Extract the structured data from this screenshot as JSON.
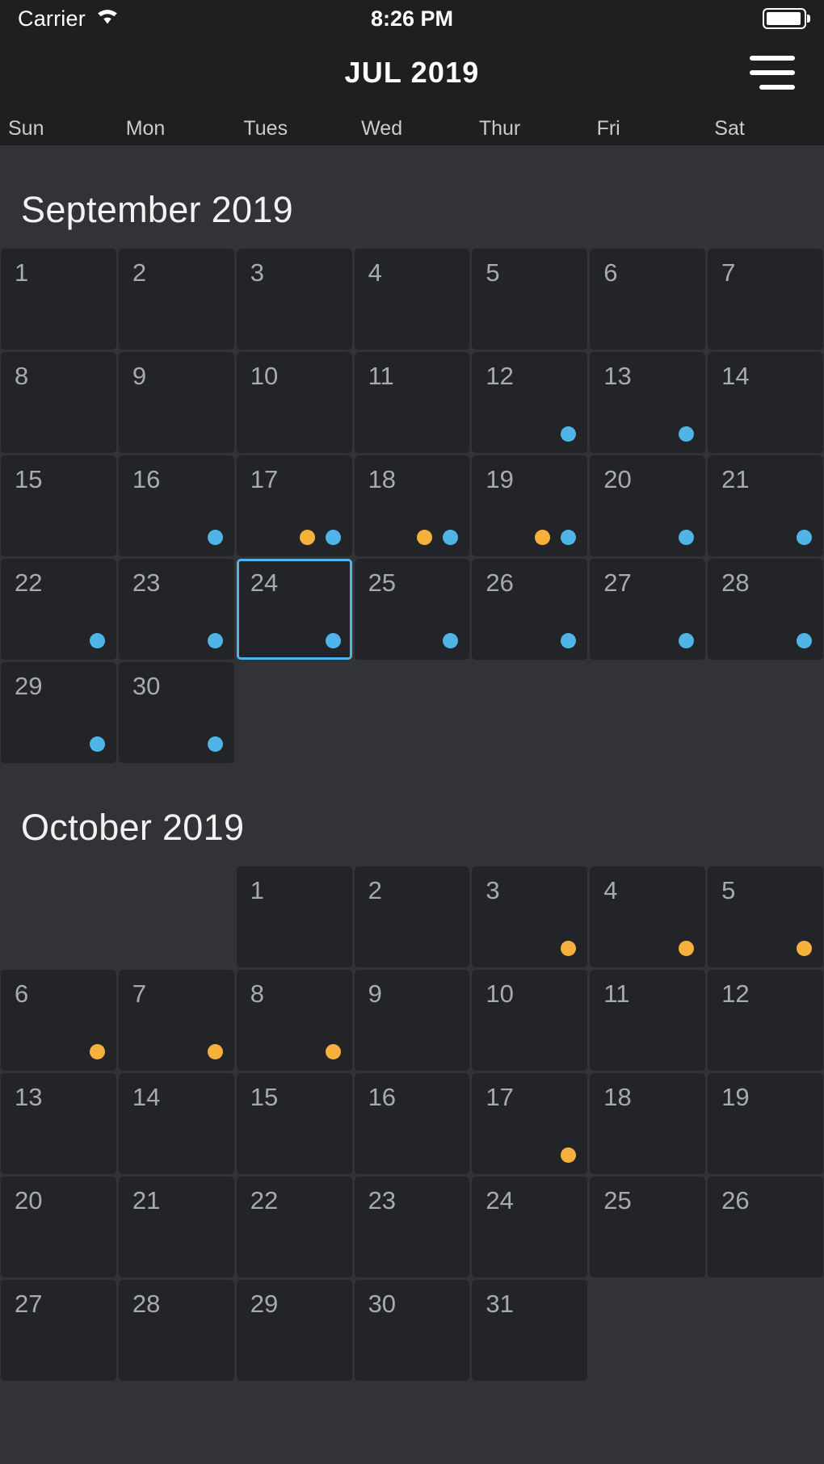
{
  "status_bar": {
    "carrier": "Carrier",
    "time": "8:26 PM",
    "wifi_icon": "wifi-icon",
    "battery_icon": "battery-icon"
  },
  "nav_bar": {
    "title": "JUL 2019",
    "menu_icon": "hamburger-menu-icon"
  },
  "weekdays": [
    "Sun",
    "Mon",
    "Tues",
    "Wed",
    "Thur",
    "Fri",
    "Sat"
  ],
  "colors": {
    "background": "#313336",
    "cell": "#232427",
    "header": "#1e1f21",
    "accent_blue": "#4fb4e8",
    "accent_orange": "#f5b13c",
    "day_text": "#a8abae",
    "title_text": "#f2f2f2"
  },
  "months": [
    {
      "title": "September 2019",
      "lead_blanks": 0,
      "days": [
        {
          "num": "1",
          "dots": []
        },
        {
          "num": "2",
          "dots": []
        },
        {
          "num": "3",
          "dots": []
        },
        {
          "num": "4",
          "dots": []
        },
        {
          "num": "5",
          "dots": []
        },
        {
          "num": "6",
          "dots": []
        },
        {
          "num": "7",
          "dots": []
        },
        {
          "num": "8",
          "dots": []
        },
        {
          "num": "9",
          "dots": []
        },
        {
          "num": "10",
          "dots": []
        },
        {
          "num": "11",
          "dots": []
        },
        {
          "num": "12",
          "dots": [
            "blue"
          ]
        },
        {
          "num": "13",
          "dots": [
            "blue"
          ]
        },
        {
          "num": "14",
          "dots": []
        },
        {
          "num": "15",
          "dots": []
        },
        {
          "num": "16",
          "dots": [
            "blue"
          ]
        },
        {
          "num": "17",
          "dots": [
            "orange",
            "blue"
          ]
        },
        {
          "num": "18",
          "dots": [
            "orange",
            "blue"
          ]
        },
        {
          "num": "19",
          "dots": [
            "orange",
            "blue"
          ]
        },
        {
          "num": "20",
          "dots": [
            "blue"
          ]
        },
        {
          "num": "21",
          "dots": [
            "blue"
          ]
        },
        {
          "num": "22",
          "dots": [
            "blue"
          ]
        },
        {
          "num": "23",
          "dots": [
            "blue"
          ]
        },
        {
          "num": "24",
          "dots": [
            "blue"
          ],
          "selected": true
        },
        {
          "num": "25",
          "dots": [
            "blue"
          ]
        },
        {
          "num": "26",
          "dots": [
            "blue"
          ]
        },
        {
          "num": "27",
          "dots": [
            "blue"
          ]
        },
        {
          "num": "28",
          "dots": [
            "blue"
          ]
        },
        {
          "num": "29",
          "dots": [
            "blue"
          ]
        },
        {
          "num": "30",
          "dots": [
            "blue"
          ]
        }
      ]
    },
    {
      "title": "October 2019",
      "lead_blanks": 2,
      "days": [
        {
          "num": "1",
          "dots": []
        },
        {
          "num": "2",
          "dots": []
        },
        {
          "num": "3",
          "dots": [
            "orange"
          ]
        },
        {
          "num": "4",
          "dots": [
            "orange"
          ]
        },
        {
          "num": "5",
          "dots": [
            "orange"
          ]
        },
        {
          "num": "6",
          "dots": [
            "orange"
          ]
        },
        {
          "num": "7",
          "dots": [
            "orange"
          ]
        },
        {
          "num": "8",
          "dots": [
            "orange"
          ]
        },
        {
          "num": "9",
          "dots": []
        },
        {
          "num": "10",
          "dots": []
        },
        {
          "num": "11",
          "dots": []
        },
        {
          "num": "12",
          "dots": []
        },
        {
          "num": "13",
          "dots": []
        },
        {
          "num": "14",
          "dots": []
        },
        {
          "num": "15",
          "dots": []
        },
        {
          "num": "16",
          "dots": []
        },
        {
          "num": "17",
          "dots": [
            "orange"
          ]
        },
        {
          "num": "18",
          "dots": []
        },
        {
          "num": "19",
          "dots": []
        },
        {
          "num": "20",
          "dots": []
        },
        {
          "num": "21",
          "dots": []
        },
        {
          "num": "22",
          "dots": []
        },
        {
          "num": "23",
          "dots": []
        },
        {
          "num": "24",
          "dots": []
        },
        {
          "num": "25",
          "dots": []
        },
        {
          "num": "26",
          "dots": []
        },
        {
          "num": "27",
          "dots": []
        },
        {
          "num": "28",
          "dots": []
        },
        {
          "num": "29",
          "dots": []
        },
        {
          "num": "30",
          "dots": []
        },
        {
          "num": "31",
          "dots": []
        }
      ]
    }
  ]
}
